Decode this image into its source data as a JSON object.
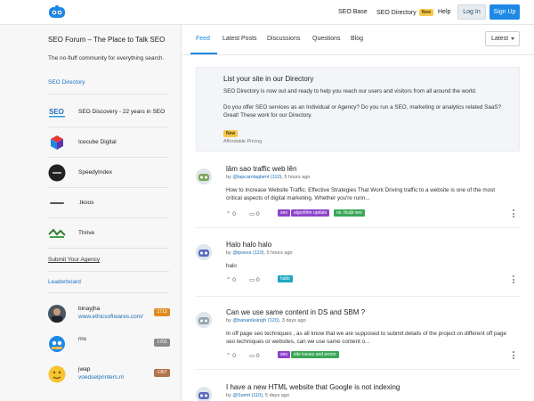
{
  "header": {
    "nav": {
      "seo_base": "SEO Base",
      "seo_directory": "SEO Directory",
      "new_badge": "New",
      "help": "Help"
    },
    "login": "Log In",
    "signup": "Sign Up"
  },
  "sidebar": {
    "title": "SEO Forum – The Place to Talk SEO",
    "tagline": "The no-fluff community for everything search.",
    "directory_heading": "SEO Directory",
    "directory": [
      {
        "name": "SEO Discovery - 22 years in SEO",
        "logo": "seo-discovery-logo"
      },
      {
        "name": "Icecube Digital",
        "logo": "icecube-logo"
      },
      {
        "name": "SpeedyIndex",
        "logo": "speedyindex-logo"
      },
      {
        "name": ".tkoos",
        "logo": "tkoos-logo"
      },
      {
        "name": "Thrive",
        "logo": "thrive-logo"
      }
    ],
    "submit_agency": "Submit Your Agency",
    "leaderboard_heading": "Leaderboard",
    "leaderboard": [
      {
        "name": "binayjha",
        "site": "www.ethicsoftwares.com/",
        "score": "1713",
        "color": "#e08a1e"
      },
      {
        "name": "rns",
        "site": "",
        "score": "1703",
        "color": "#8a8a8a"
      },
      {
        "name": "jwap",
        "site": "voedselprinters.nl",
        "score": "1367",
        "color": "#b5714a"
      }
    ]
  },
  "tabs": [
    "Feed",
    "Latest Posts",
    "Discussions",
    "Questions",
    "Blog"
  ],
  "sort": "Latest",
  "promo": {
    "title": "List your site in our Directory",
    "line1": "SEO Directory is now out and ready to help you reach our users and visitors from all around the world.",
    "line2": "Do you offer SEO services as an Individual or Agency? Do you run a SEO, marketing or analytics related SaaS? Great! These work for our Directory.",
    "badge": "New",
    "footer": "Affordable Pricing"
  },
  "posts": [
    {
      "title": "lâm sao traffic web lên",
      "by": "by",
      "user": "@lapcamlaglamt (110)",
      "time": ", 5 hours ago",
      "excerpt": "How to Increase Website Traffic: Effective Strategies That Work Driving traffic to a website is one of the most critical aspects of digital marketing. Whether you're runn...",
      "votes": "0",
      "comments": "0",
      "tags": [
        {
          "label": "seo",
          "color": "#8e44c9"
        },
        {
          "label": "algorithm update",
          "color": "#8e44c9"
        },
        {
          "label": "ris. thuật seo",
          "color": "#3aa757"
        }
      ]
    },
    {
      "title": "Halo halo halo",
      "by": "by",
      "user": "@ipsexs (110)",
      "time": ", 5 hours ago",
      "excerpt": "halo",
      "votes": "0",
      "comments": "0",
      "tags": [
        {
          "label": "hallo",
          "color": "#20a9c2"
        }
      ]
    },
    {
      "title": "Can we use same content in DS and SBM ?",
      "by": "by",
      "user": "@bananiksingh (120)",
      "time": ", 3 days ago",
      "excerpt": "In off page seo techniques , as all know that we are supposed to submit details of the project on different off page seo techniques or websites, can we use same content o...",
      "votes": "0",
      "comments": "0",
      "tags": [
        {
          "label": "seo",
          "color": "#8e44c9"
        },
        {
          "label": "site issues and errors",
          "color": "#3aa757"
        }
      ]
    },
    {
      "title": "I have a new HTML website that Google is not indexing",
      "by": "by",
      "user": "@Samit (110)",
      "time": ", 5 days ago",
      "excerpt": "",
      "votes": "",
      "comments": "",
      "tags": []
    }
  ]
}
